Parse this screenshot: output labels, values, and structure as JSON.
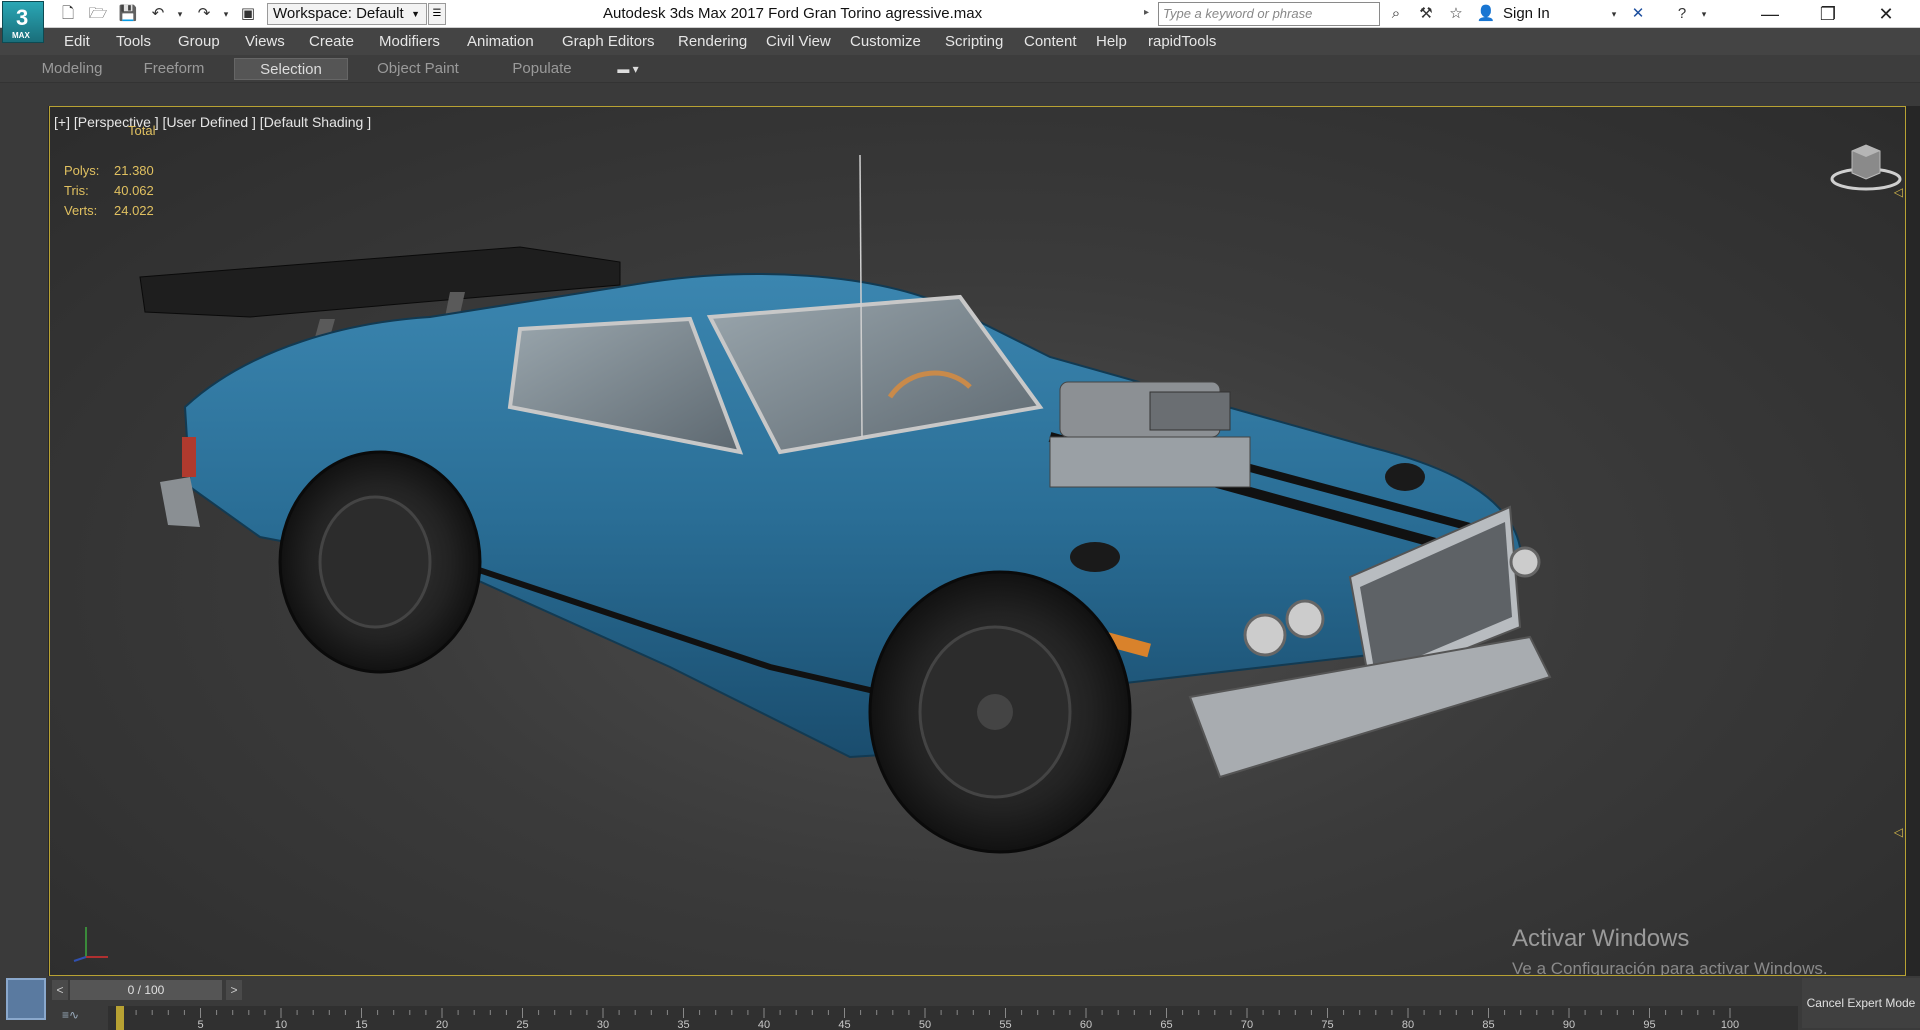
{
  "app": {
    "logo_main": "3",
    "logo_sub": "MAX",
    "title": "Autodesk 3ds Max 2017    Ford Gran Torino agressive.max",
    "workspace": "Workspace: Default",
    "search_placeholder": "Type a keyword or phrase",
    "sign_in": "Sign In"
  },
  "menu": [
    "Edit",
    "Tools",
    "Group",
    "Views",
    "Create",
    "Modifiers",
    "Animation",
    "Graph Editors",
    "Rendering",
    "Civil View",
    "Customize",
    "Scripting",
    "Content",
    "Help",
    "rapidTools"
  ],
  "ribbon": {
    "tabs": [
      "Modeling",
      "Freeform",
      "Selection",
      "Object Paint",
      "Populate"
    ],
    "active_tab": "Selection"
  },
  "viewport": {
    "label": "[+] [Perspective ] [User Defined ] [Default Shading ]",
    "stats": {
      "header": "Total",
      "rows": [
        {
          "key": "Polys:",
          "value": "21.380"
        },
        {
          "key": "Tris:",
          "value": "40.062"
        },
        {
          "key": "Verts:",
          "value": "24.022"
        }
      ]
    },
    "watermark_title": "Activar Windows",
    "watermark_sub": "Ve a Configuración para activar Windows."
  },
  "timeline": {
    "frame_display": "0 / 100",
    "prev": "<",
    "next": ">",
    "ticks": [
      "5",
      "10",
      "15",
      "20",
      "25",
      "30",
      "35",
      "40",
      "45",
      "50",
      "55",
      "60",
      "65",
      "70",
      "75",
      "80",
      "85",
      "90",
      "95",
      "100"
    ],
    "cancel_expert": "Cancel Expert Mode"
  },
  "colors": {
    "car_body": "#2a6e96",
    "viewport_border": "#b8a233",
    "stats_text": "#e0c060"
  }
}
